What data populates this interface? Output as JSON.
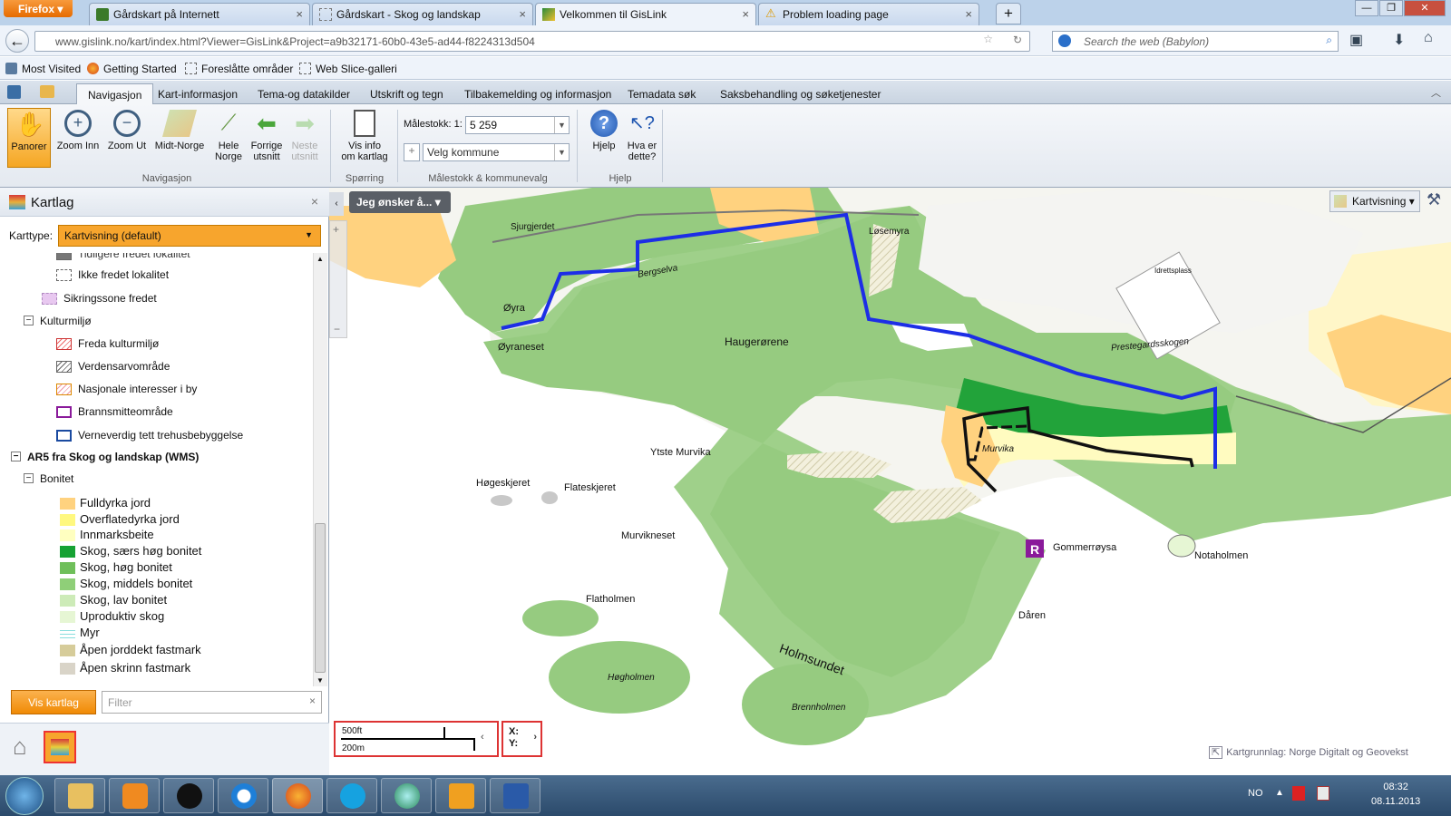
{
  "browser": {
    "menu_button": "Firefox",
    "tabs": [
      {
        "title": "Gårdskart på Internett"
      },
      {
        "title": "Gårdskart - Skog og landskap"
      },
      {
        "title": "Velkommen til GisLink"
      },
      {
        "title": "Problem loading page"
      }
    ],
    "url": "www.gislink.no/kart/index.html?Viewer=GisLink&Project=a9b32171-60b0-43e5-ad44-f8224313d504",
    "search_placeholder": "Search the web (Babylon)",
    "bookmarks": [
      "Most Visited",
      "Getting Started",
      "Foreslåtte områder",
      "Web Slice-galleri"
    ]
  },
  "ribbon": {
    "tabs": [
      "Navigasjon",
      "Kart-informasjon",
      "Tema-og datakilder",
      "Utskrift og tegn",
      "Tilbakemelding og informasjon",
      "Temadata søk",
      "Saksbehandling og søketjenester"
    ],
    "buttons": {
      "panorer": "Panorer",
      "zoom_inn": "Zoom Inn",
      "zoom_ut": "Zoom Ut",
      "midt_norge": "Midt-Norge",
      "hele_norge_1": "Hele",
      "hele_norge_2": "Norge",
      "forrige_1": "Forrige",
      "forrige_2": "utsnitt",
      "neste_1": "Neste",
      "neste_2": "utsnitt",
      "visinfo_1": "Vis info",
      "visinfo_2": "om kartlag",
      "hjelp": "Hjelp",
      "hva_1": "Hva er",
      "hva_2": "dette?"
    },
    "scale_label": "Målestokk: 1:",
    "scale_value": "5 259",
    "kommune_placeholder": "Velg kommune",
    "groups": {
      "navigasjon": "Navigasjon",
      "sporring": "Spørring",
      "malestokk": "Målestokk & kommunevalg",
      "hjelp": "Hjelp"
    }
  },
  "panel": {
    "title": "Kartlag",
    "karttype_label": "Karttype:",
    "karttype_value": "Kartvisning (default)",
    "items": [
      {
        "label": "Tidligere fredet lokalitet"
      },
      {
        "label": "Ikke fredet lokalitet"
      },
      {
        "label": "Sikringssone fredet"
      },
      {
        "label": "Kulturmiljø"
      },
      {
        "label": "Freda kulturmiljø"
      },
      {
        "label": "Verdensarvområde"
      },
      {
        "label": "Nasjonale interesser i by"
      },
      {
        "label": "Brannsmitteområde"
      },
      {
        "label": "Verneverdig tett trehusbebyggelse"
      },
      {
        "label": "AR5 fra Skog og landskap (WMS)"
      },
      {
        "label": "Bonitet"
      },
      {
        "label": "Fulldyrka jord"
      },
      {
        "label": "Overflatedyrka jord"
      },
      {
        "label": "Innmarksbeite"
      },
      {
        "label": "Skog, særs høg bonitet"
      },
      {
        "label": "Skog, høg bonitet"
      },
      {
        "label": "Skog, middels bonitet"
      },
      {
        "label": "Skog, lav bonitet"
      },
      {
        "label": "Uproduktiv skog"
      },
      {
        "label": "Myr"
      },
      {
        "label": "Åpen jorddekt fastmark"
      },
      {
        "label": "Åpen skrinn fastmark"
      }
    ],
    "vis_button": "Vis kartlag",
    "filter_placeholder": "Filter"
  },
  "map": {
    "jeg_button": "Jeg ønsker å...",
    "kartvisning": "Kartvisning",
    "labels": [
      "Sjurgjerdet",
      "Øyraneset",
      "Øyra",
      "Bergselva",
      "Haugerørene",
      "Løsemyra",
      "Idrettsplass",
      "Prestegardsskogen",
      "Ytste Murvika",
      "Murvika",
      "Høgeskjeret",
      "Flateskjeret",
      "Murvikneset",
      "Gommerrøysa",
      "Notaholmen",
      "Flatholmen",
      "Dåren",
      "Holmsundet",
      "Høgholmen",
      "Brennholmen"
    ],
    "scale_ft": "500ft",
    "scale_m": "200m",
    "x_label": "X:",
    "y_label": "Y:",
    "attribution": "Kartgrunnlag: Norge Digitalt og Geovekst"
  },
  "taskbar": {
    "lang": "NO",
    "time": "08:32",
    "date": "08.11.2013"
  }
}
